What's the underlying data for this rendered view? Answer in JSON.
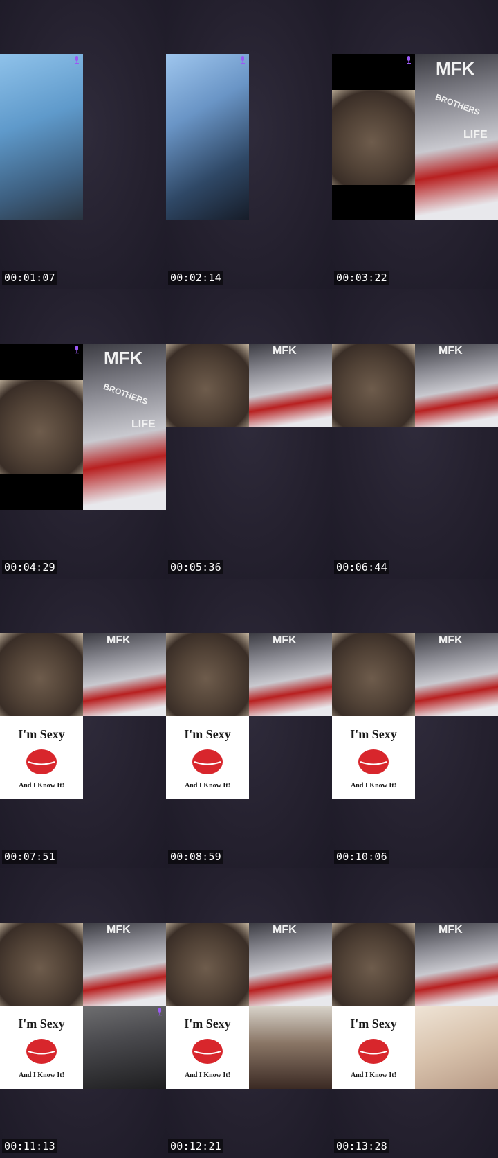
{
  "frames": [
    {
      "timestamp": "00:01:07"
    },
    {
      "timestamp": "00:02:14"
    },
    {
      "timestamp": "00:03:22"
    },
    {
      "timestamp": "00:04:29"
    },
    {
      "timestamp": "00:05:36"
    },
    {
      "timestamp": "00:06:44"
    },
    {
      "timestamp": "00:07:51"
    },
    {
      "timestamp": "00:08:59"
    },
    {
      "timestamp": "00:10:06"
    },
    {
      "timestamp": "00:11:13"
    },
    {
      "timestamp": "00:12:21"
    },
    {
      "timestamp": "00:13:28"
    }
  ],
  "poster": {
    "brand": "MFK",
    "line1": "BROTHERS",
    "line2": "LIFE"
  },
  "sexy_card": {
    "title": "I'm Sexy",
    "subtitle": "And I Know It!"
  },
  "colors": {
    "background": "#201d2c",
    "mic_icon": "#9b59f5",
    "lips": "#d8262c"
  },
  "icons": {
    "speaking": "microphone-icon"
  }
}
